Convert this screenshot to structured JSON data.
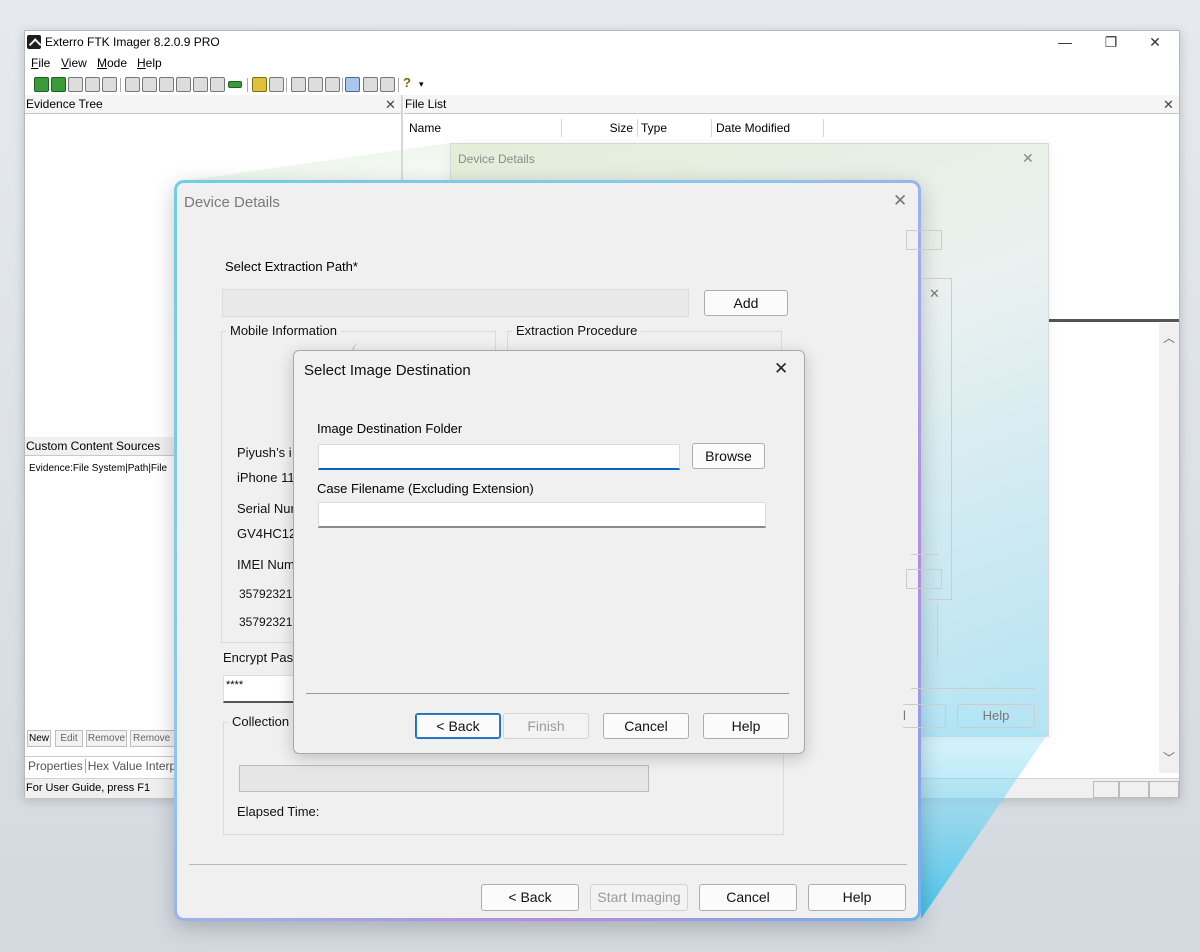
{
  "app": {
    "title": "Exterro FTK Imager 8.2.0.9 PRO",
    "window_controls": {
      "minimize": "—",
      "restore": "❐",
      "close": "✕"
    },
    "menu": [
      {
        "underline": "F",
        "rest": "ile"
      },
      {
        "underline": "V",
        "rest": "iew"
      },
      {
        "underline": "M",
        "rest": "ode"
      },
      {
        "underline": "H",
        "rest": "elp"
      }
    ],
    "toolbar_icons": [
      "add-evidence-icon",
      "add-all-evidence-icon",
      "image-mounting-icon",
      "remove-evidence-icon",
      "remove-all-icon",
      "create-image-icon",
      "export-image-icon",
      "verify-drive-icon",
      "capture-memory-icon",
      "obtain-protected-files-icon",
      "detect-efs-icon",
      "export-files-icon",
      "export-hash-icon",
      "add-to-custom-content-icon",
      "create-custom-image-icon",
      "view-files-icon",
      "text-view-icon",
      "hex-view-icon",
      "help-icon"
    ],
    "evidence_tree": {
      "title": "Evidence Tree",
      "close": "✕"
    },
    "file_list": {
      "title": "File List",
      "close": "✕",
      "columns": [
        "Name",
        "Size",
        "Type",
        "Date Modified"
      ]
    },
    "custom_content": {
      "title": "Custom Content Sources",
      "entry": "Evidence:File System|Path|File",
      "buttons": [
        "New",
        "Edit",
        "Remove",
        "Remove A"
      ]
    },
    "bottom_tabs": [
      "Properties",
      "Hex Value Interpre"
    ],
    "status": "For User Guide, press F1"
  },
  "bg_dialog": {
    "title": "Device Details",
    "close": "✕",
    "inner_close": "✕",
    "buttons": [
      "l",
      "Help"
    ]
  },
  "device_dialog": {
    "title": "Device Details",
    "close": "✕",
    "extraction_path_label": "Select Extraction Path*",
    "add_button": "Add",
    "mobile_info_label": "Mobile Information",
    "extraction_procedure_label": "Extraction Procedure",
    "device_name": "Piyush’s i",
    "device_model": "iPhone 11",
    "serial_label": "Serial Nur",
    "serial_value": "GV4HC12",
    "imei_label": "IMEI Num",
    "imei_1": "35792321",
    "imei_2": "35792321",
    "encrypt_label": "Encrypt Pas",
    "encrypt_value": "****",
    "collection_label": "Collection",
    "elapsed_label": "Elapsed Time:",
    "buttons": {
      "back": "< Back",
      "start": "Start Imaging",
      "cancel": "Cancel",
      "help": "Help"
    }
  },
  "select_dest_dialog": {
    "title": "Select Image Destination",
    "close": "✕",
    "folder_label": "Image Destination Folder",
    "folder_value": "",
    "browse": "Browse",
    "filename_label": "Case Filename (Excluding Extension)",
    "filename_value": "",
    "buttons": {
      "back": "< Back",
      "finish": "Finish",
      "cancel": "Cancel",
      "help": "Help"
    }
  },
  "colors": {
    "accent": "#0067c0",
    "beam": "#4fc8ee",
    "dialog_border_start": "#6fcfe0",
    "dialog_border_mid": "#b48be0"
  }
}
